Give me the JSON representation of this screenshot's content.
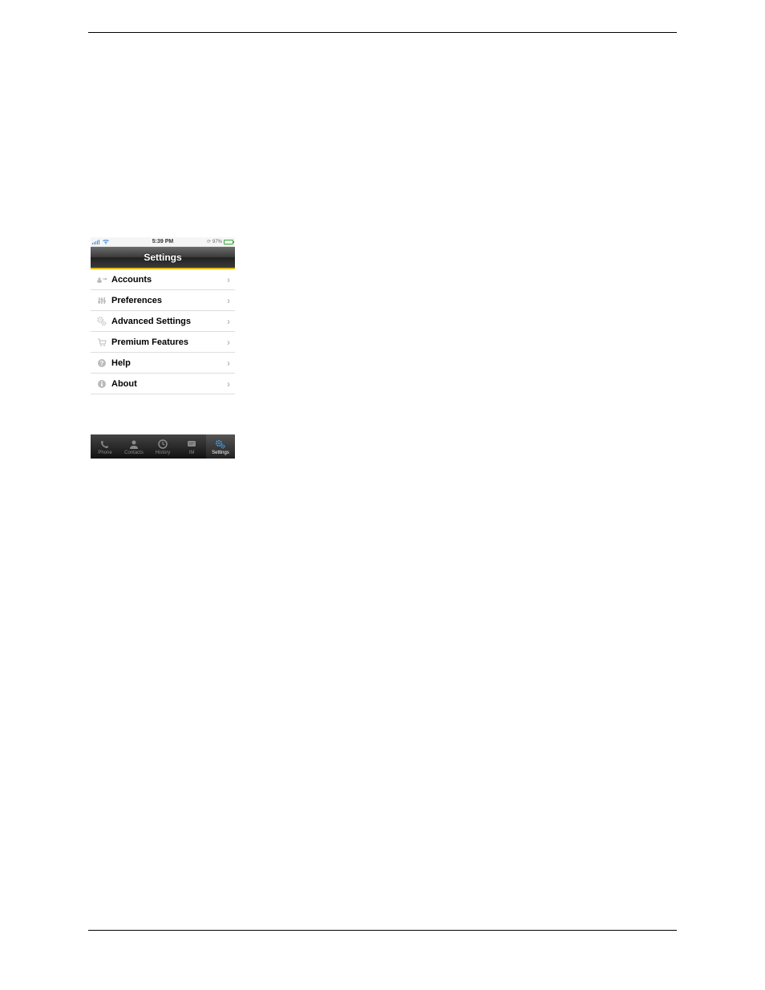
{
  "statusbar": {
    "time": "5:39 PM",
    "battery_text": "97%"
  },
  "navbar": {
    "title": "Settings"
  },
  "settings_rows": [
    {
      "label": "Accounts"
    },
    {
      "label": "Preferences"
    },
    {
      "label": "Advanced Settings"
    },
    {
      "label": "Premium Features"
    },
    {
      "label": "Help"
    },
    {
      "label": "About"
    }
  ],
  "tabbar": [
    {
      "label": "Phone"
    },
    {
      "label": "Contacts"
    },
    {
      "label": "History"
    },
    {
      "label": "IM"
    },
    {
      "label": "Settings"
    }
  ]
}
